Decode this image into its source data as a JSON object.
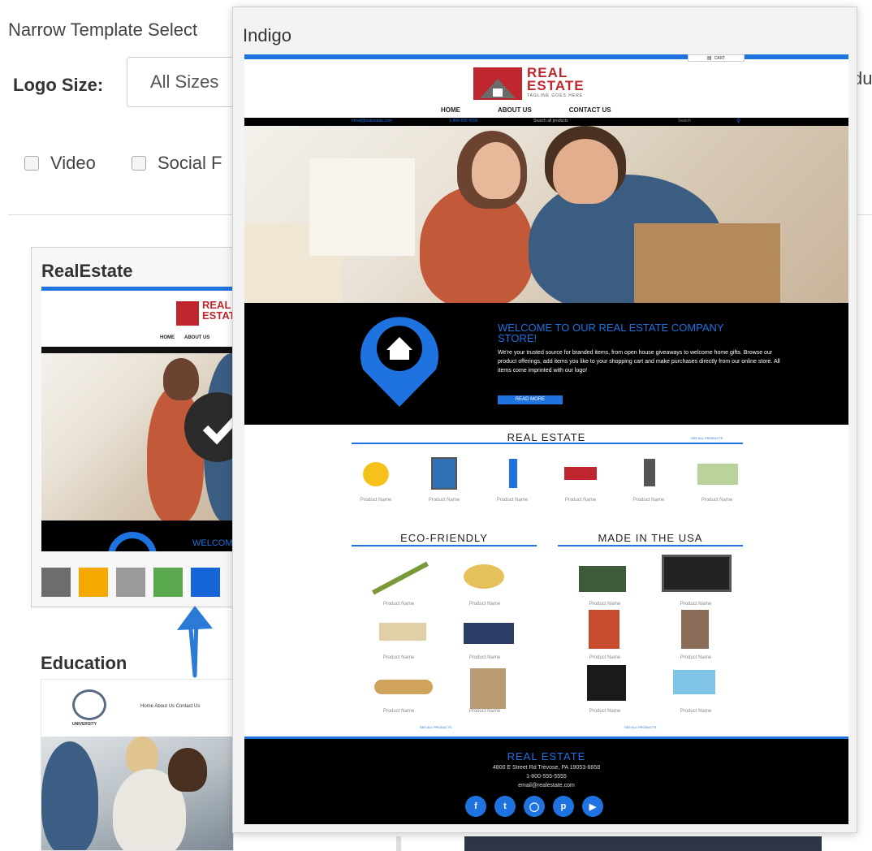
{
  "filters": {
    "narrow_label": "Narrow Template Select",
    "logo_size_label": "Logo Size:",
    "logo_size_value": "All Sizes",
    "cut_text": "du",
    "checkbox_video": "Video",
    "checkbox_social": "Social F"
  },
  "templates": [
    {
      "name": "RealEstate",
      "swatches": [
        "#6d6d6d",
        "#f5a800",
        "#9a9a9a",
        "#5aa84d",
        "#1565d8"
      ]
    },
    {
      "name": "Education"
    }
  ],
  "thumbnail": {
    "logo_line1": "REAL",
    "logo_line2": "ESTATE",
    "nav_home": "HOME",
    "nav_about": "ABOUT US",
    "welcome_cut": "WELCOM",
    "edu_nav": "Home  About Us  Contact Us",
    "edu_logo": "UNIVERSITY"
  },
  "popup": {
    "title": "Indigo",
    "site": {
      "cart": "CART",
      "logo_line1": "REAL",
      "logo_line2": "ESTATE",
      "tagline": "TAGLINE GOES HERE",
      "nav": [
        "HOME",
        "ABOUT US",
        "CONTACT US"
      ],
      "topbar_email": "email@realestate.com",
      "topbar_phone": "1-800-555-5555",
      "topbar_search": "Search all products",
      "topbar_search_btn": "Search",
      "welcome_title": "WELCOME TO OUR REAL ESTATE COMPANY STORE!",
      "welcome_body": "We're your trusted source for branded items, from open house giveaways to welcome home gifts. Browse our product offerings, add items you like to your shopping cart and make purchases directly from our online store. All items come imprinted with our logo!",
      "read_more": "READ MORE",
      "section_realestate": "REAL ESTATE",
      "section_eco": "ECO-FRIENDLY",
      "section_usa": "MADE IN THE USA",
      "see_all": "SEE ALL PRODUCTS",
      "product_name": "Product Name",
      "footer_title": "REAL ESTATE",
      "footer_address": "4800 E Street Rd Trevose, PA 19053-6658",
      "footer_phone": "1-800-555-5555",
      "footer_email": "email@realestate.com"
    }
  },
  "colors": {
    "accent": "#1e73e0",
    "dark": "#000000",
    "logo_red": "#c0262d"
  }
}
